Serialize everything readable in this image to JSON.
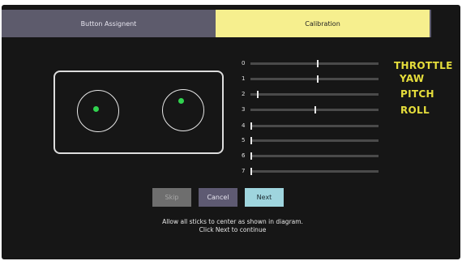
{
  "tabs": [
    {
      "label": "Button Assignent",
      "active": false
    },
    {
      "label": "Calibration",
      "active": true
    }
  ],
  "colors": {
    "tab_active": "#f6ef8e",
    "tab_inactive": "#5d5b6c",
    "axis_label": "#e6de3c",
    "stick_dot": "#31d34f",
    "background": "#161616"
  },
  "diagram": {
    "left_stick": "left-stick",
    "right_stick": "right-stick"
  },
  "channels": [
    {
      "number": "0",
      "position": 0.52
    },
    {
      "number": "1",
      "position": 0.52
    },
    {
      "number": "2",
      "position": 0.05
    },
    {
      "number": "3",
      "position": 0.5
    },
    {
      "number": "4",
      "position": 0.0
    },
    {
      "number": "5",
      "position": 0.0
    },
    {
      "number": "6",
      "position": 0.0
    },
    {
      "number": "7",
      "position": 0.0
    }
  ],
  "axis_labels": {
    "throttle": "THROTTLE",
    "yaw": "YAW",
    "pitch": "PITCH",
    "roll": "ROLL"
  },
  "buttons": {
    "skip": "Skip",
    "cancel": "Cancel",
    "next": "Next"
  },
  "instructions": {
    "line1": "Allow all sticks to center as shown in diagram.",
    "line2": "Click Next to continue"
  }
}
